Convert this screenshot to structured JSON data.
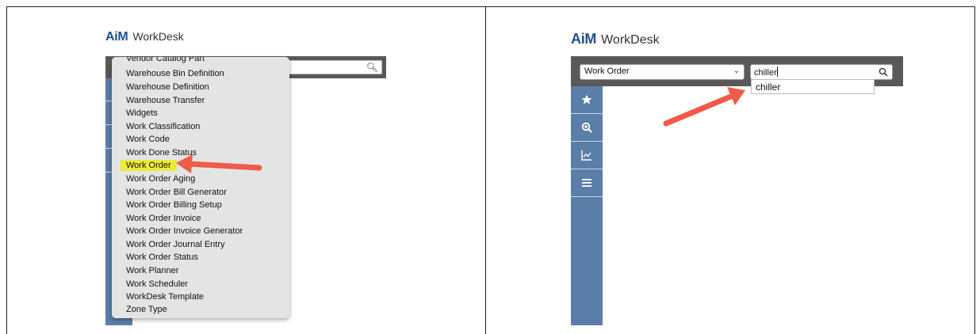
{
  "left_panel": {
    "logo": {
      "brand": "AiM",
      "product": "WorkDesk"
    },
    "dropdown": {
      "options": [
        "Vendor Catalog Part",
        "Warehouse Bin Definition",
        "Warehouse Definition",
        "Warehouse Transfer",
        "Widgets",
        "Work Classification",
        "Work Code",
        "Work Done Status",
        "Work Order",
        "Work Order Aging",
        "Work Order Bill Generator",
        "Work Order Billing Setup",
        "Work Order Invoice",
        "Work Order Invoice Generator",
        "Work Order Journal Entry",
        "Work Order Status",
        "Work Planner",
        "Work Scheduler",
        "WorkDesk Template",
        "Zone Type"
      ],
      "highlighted_option": "Work Order",
      "highlight_color": "#ebeb38"
    }
  },
  "right_panel": {
    "logo": {
      "brand": "AiM",
      "product": "WorkDesk"
    },
    "search": {
      "type_select_value": "Work Order",
      "query_value": "chiller",
      "suggestions": [
        "chiller"
      ]
    },
    "rail_icons": [
      "star-icon",
      "zoom-in-icon",
      "chart-icon",
      "menu-icon"
    ]
  },
  "colors": {
    "brand": "#1e4f8a",
    "toolbar": "#595959",
    "rail": "#5a7ea8",
    "arrow": "#f05a48"
  }
}
